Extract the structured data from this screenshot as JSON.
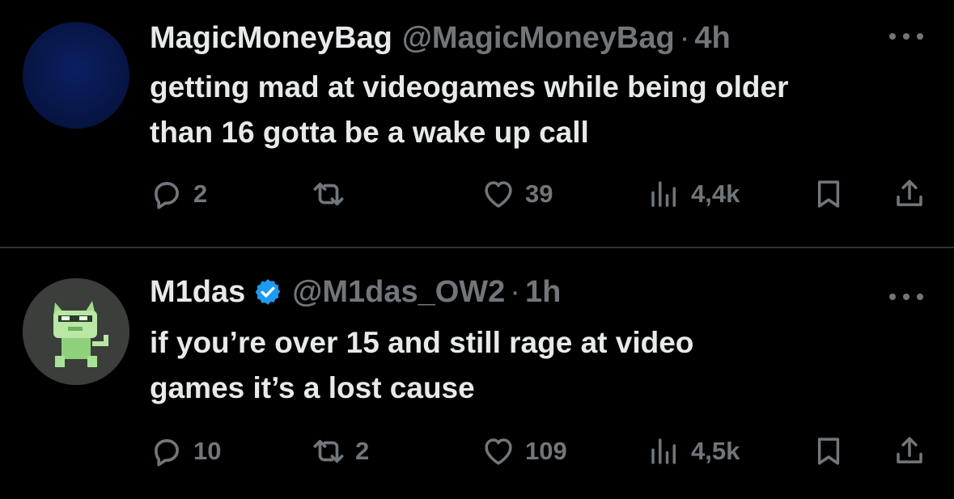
{
  "tweets": [
    {
      "display_name": "MagicMoneyBag",
      "handle": "@MagicMoneyBag",
      "separator": "·",
      "time": "4h",
      "verified": false,
      "text": "getting mad at videogames while being older\nthan 16 gotta be a wake up call",
      "stats": {
        "replies": "2",
        "retweets": "",
        "likes": "39",
        "views": "4,4k"
      }
    },
    {
      "display_name": "M1das",
      "handle": "@M1das_OW2",
      "separator": "·",
      "time": "1h",
      "verified": true,
      "text": "if you’re over 15 and still rage at video\ngames it’s a lost cause",
      "stats": {
        "replies": "10",
        "retweets": "2",
        "likes": "109",
        "views": "4,5k"
      }
    }
  ],
  "colors": {
    "background": "#000000",
    "text_primary": "#e7e9ea",
    "text_secondary": "#71767b",
    "divider": "#2f3336",
    "verified_blue": "#1d9bf0"
  },
  "icons": [
    "reply-icon",
    "retweet-icon",
    "like-icon",
    "views-icon",
    "bookmark-icon",
    "share-icon",
    "more-icon",
    "verified-badge-icon"
  ]
}
